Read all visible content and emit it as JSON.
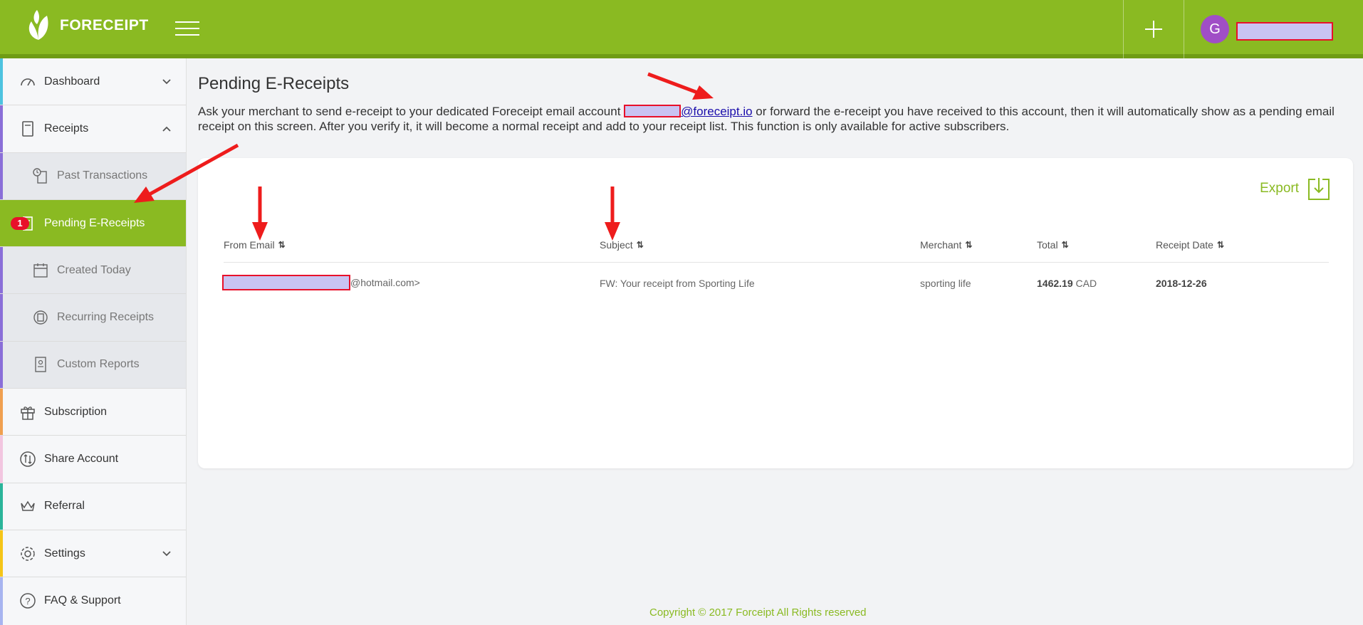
{
  "app": {
    "brand": "FORECEIPT",
    "avatar_initial": "G",
    "accent_color": "#8aba22",
    "alert_color": "#e8102a"
  },
  "sidebar": {
    "items": [
      {
        "label": "Dashboard",
        "icon": "speedometer-icon",
        "stripe": "#4ec3e0"
      },
      {
        "label": "Receipts",
        "icon": "receipt-icon",
        "stripe": "#8a6fd8"
      },
      {
        "label": "Past Transactions",
        "icon": "history-icon",
        "stripe": "#8a6fd8"
      },
      {
        "label": "Pending E-Receipts",
        "icon": "document-icon",
        "badge": "1",
        "stripe": "#8a6fd8"
      },
      {
        "label": "Created Today",
        "icon": "calendar-icon",
        "stripe": "#8a6fd8"
      },
      {
        "label": "Recurring Receipts",
        "icon": "recurring-icon",
        "stripe": "#8a6fd8"
      },
      {
        "label": "Custom Reports",
        "icon": "report-icon",
        "stripe": "#8a6fd8"
      },
      {
        "label": "Subscription",
        "icon": "gift-icon",
        "stripe": "#f0a050"
      },
      {
        "label": "Share Account",
        "icon": "share-icon",
        "stripe": "#f2c6e0"
      },
      {
        "label": "Referral",
        "icon": "crown-icon",
        "stripe": "#2ab49a"
      },
      {
        "label": "Settings",
        "icon": "gear-icon",
        "stripe": "#f5c518"
      },
      {
        "label": "FAQ & Support",
        "icon": "question-icon",
        "stripe": "#a7b4f0"
      }
    ]
  },
  "main": {
    "title": "Pending E-Receipts",
    "desc_before": "Ask your merchant to send e-receipt to your dedicated Foreceipt email account ",
    "desc_email_domain": "@foreceipt.io",
    "desc_after": " or forward the e-receipt you have received to this account, then it will automatically show as a pending email receipt on this screen. After you verify it, it will become a normal receipt and add to your receipt list. This function is only available for active subscribers.",
    "export_label": "Export",
    "table": {
      "columns": [
        "From Email",
        "Subject",
        "Merchant",
        "Total",
        "Receipt Date"
      ],
      "rows": [
        {
          "from_suffix": "@hotmail.com>",
          "subject": "FW: Your receipt from Sporting Life",
          "merchant": "sporting life",
          "total_amount": "1462.19",
          "total_currency": "CAD",
          "date": "2018-12-26"
        }
      ]
    }
  },
  "footer": {
    "copyright": "Copyright © 2017 Forceipt All Rights reserved"
  }
}
